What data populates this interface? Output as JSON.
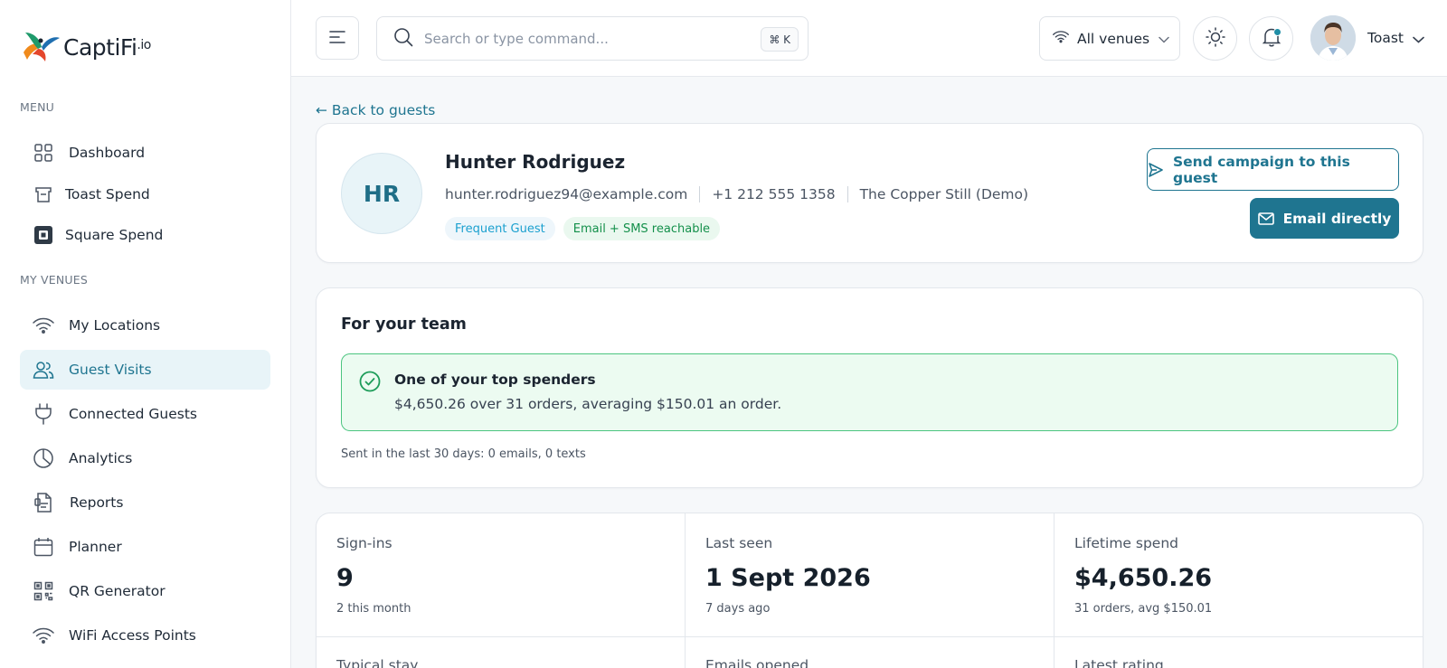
{
  "brand": {
    "name": "CaptiFi",
    "suffix": ".io",
    "colors": {
      "accent": "#1f7590",
      "success": "#4cc580"
    }
  },
  "sidebar": {
    "menu_label": "MENU",
    "menu_items": [
      {
        "label": "Dashboard",
        "icon": "grid-icon"
      },
      {
        "label": "Toast Spend",
        "icon": "toast-icon"
      },
      {
        "label": "Square Spend",
        "icon": "square-icon"
      }
    ],
    "venues_label": "MY VENUES",
    "venue_items": [
      {
        "label": "My Locations",
        "icon": "wifi-icon"
      },
      {
        "label": "Guest Visits",
        "icon": "users-icon",
        "active": true
      },
      {
        "label": "Connected Guests",
        "icon": "plug-icon"
      },
      {
        "label": "Analytics",
        "icon": "pie-chart-icon"
      },
      {
        "label": "Reports",
        "icon": "report-icon"
      },
      {
        "label": "Planner",
        "icon": "calendar-icon"
      },
      {
        "label": "QR Generator",
        "icon": "qr-icon"
      },
      {
        "label": "WiFi Access Points",
        "icon": "wifi-icon"
      }
    ]
  },
  "topbar": {
    "search_placeholder": "Search or type command...",
    "shortcut": "⌘ K",
    "venue_select": "All venues",
    "user_name": "Toast"
  },
  "guest": {
    "back_label": "← Back to guests",
    "initials": "HR",
    "name": "Hunter Rodriguez",
    "email": "hunter.rodriguez94@example.com",
    "phone": "+1 212 555 1358",
    "venue": "The Copper Still (Demo)",
    "badges": [
      "Frequent Guest",
      "Email + SMS reachable"
    ],
    "send_campaign_label": "Send campaign to this guest",
    "email_directly_label": "Email directly"
  },
  "team": {
    "title": "For your team",
    "alert_title": "One of your top spenders",
    "alert_body": "$4,650.26 over 31 orders, averaging $150.01 an order.",
    "sent_note": "Sent in the last 30 days: 0 emails, 0 texts"
  },
  "stats": [
    {
      "label": "Sign-ins",
      "value": "9",
      "sub": "2 this month"
    },
    {
      "label": "Last seen",
      "value": "1 Sept 2026",
      "sub": "7 days ago"
    },
    {
      "label": "Lifetime spend",
      "value": "$4,650.26",
      "sub": "31 orders, avg $150.01"
    }
  ],
  "stats_row2": [
    {
      "label": "Typical stay"
    },
    {
      "label": "Emails opened"
    },
    {
      "label": "Latest rating"
    }
  ]
}
